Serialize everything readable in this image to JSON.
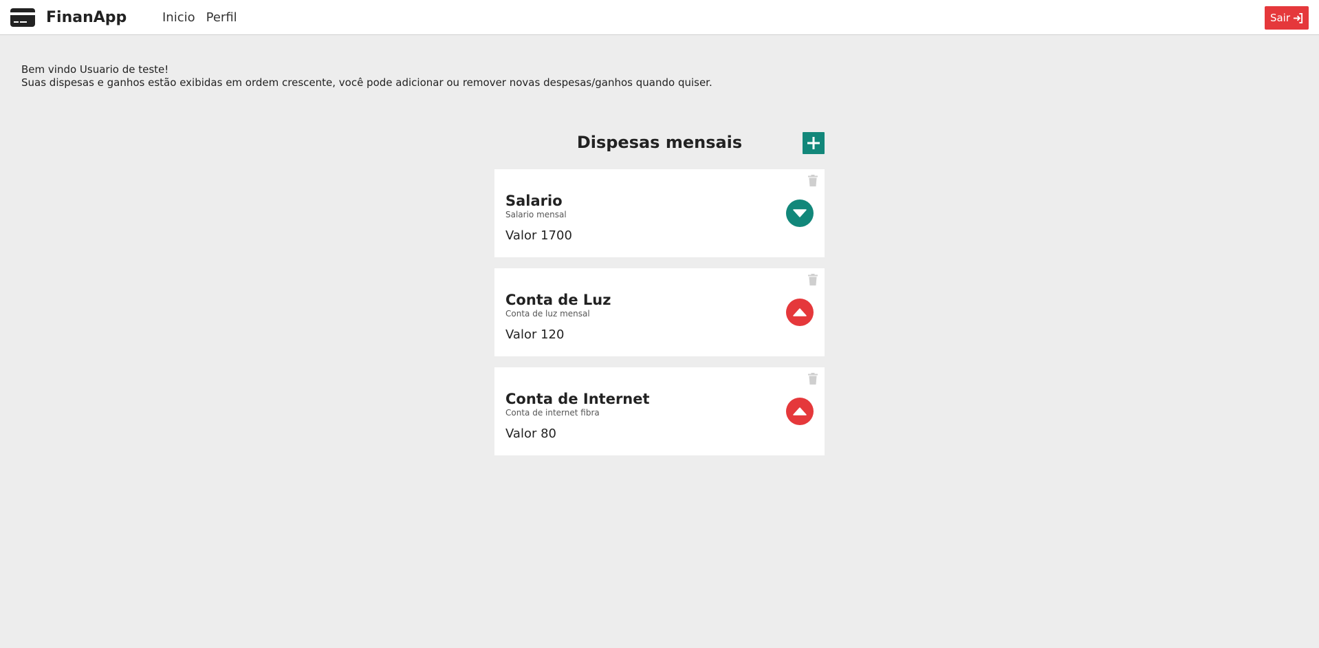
{
  "navbar": {
    "brand": "FinanApp",
    "links": [
      "Inicio",
      "Perfil"
    ],
    "logout_label": "Sair"
  },
  "welcome": {
    "line1": "Bem vindo Usuario de teste!",
    "line2": "Suas dispesas e ganhos estão exibidas em ordem crescente, você pode adicionar ou remover novas despesas/ganhos quando quiser."
  },
  "section": {
    "title": "Dispesas mensais"
  },
  "entries": [
    {
      "title": "Salario",
      "description": "Salario mensal",
      "value": "Valor 1700",
      "type": "income",
      "icon": "caret-down-icon"
    },
    {
      "title": "Conta de Luz",
      "description": "Conta de luz mensal",
      "value": "Valor 120",
      "type": "expense",
      "icon": "caret-up-icon"
    },
    {
      "title": "Conta de Internet",
      "description": "Conta de internet fibra",
      "value": "Valor 80",
      "type": "expense",
      "icon": "caret-up-icon"
    }
  ],
  "colors": {
    "income": "#12877a",
    "expense": "#e5383b",
    "background": "#ededed"
  }
}
